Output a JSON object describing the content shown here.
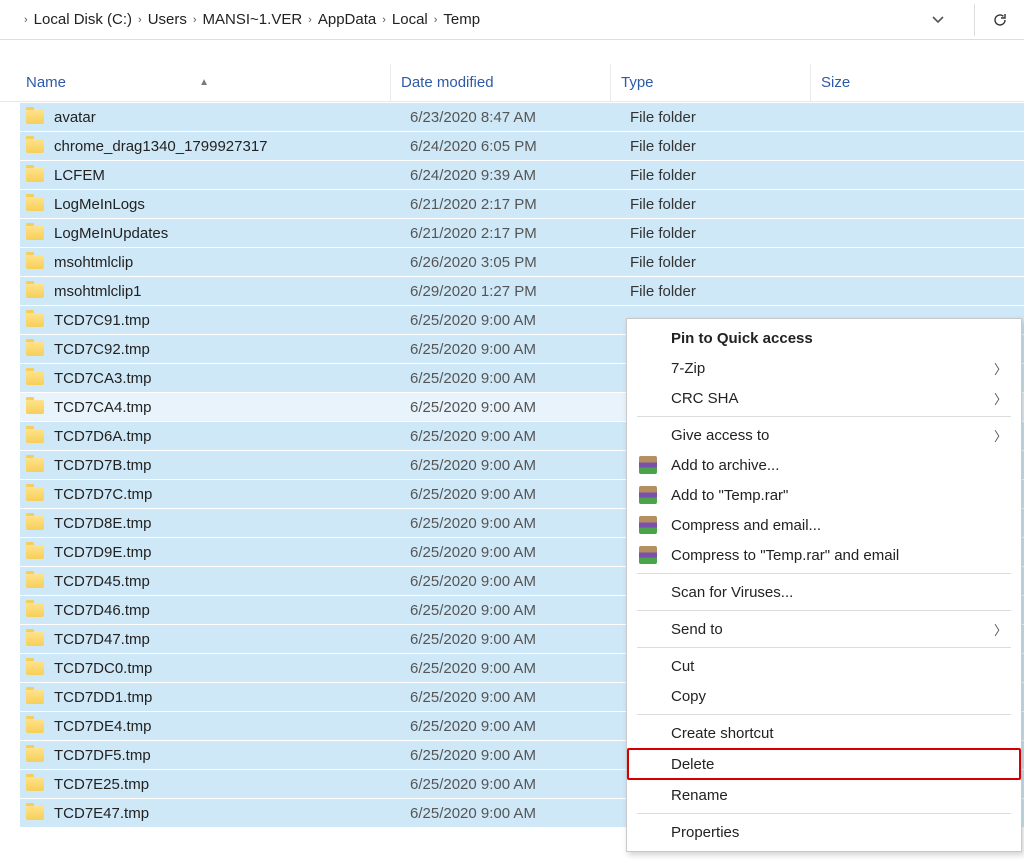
{
  "breadcrumbs": [
    {
      "label": "Local Disk (C:)"
    },
    {
      "label": "Users"
    },
    {
      "label": "MANSI~1.VER"
    },
    {
      "label": "AppData"
    },
    {
      "label": "Local"
    },
    {
      "label": "Temp"
    }
  ],
  "columns": {
    "name": "Name",
    "date": "Date modified",
    "type": "Type",
    "size": "Size"
  },
  "rows": [
    {
      "name": "avatar",
      "date": "6/23/2020 8:47 AM",
      "type": "File folder"
    },
    {
      "name": "chrome_drag1340_1799927317",
      "date": "6/24/2020 6:05 PM",
      "type": "File folder"
    },
    {
      "name": "LCFEM",
      "date": "6/24/2020 9:39 AM",
      "type": "File folder"
    },
    {
      "name": "LogMeInLogs",
      "date": "6/21/2020 2:17 PM",
      "type": "File folder"
    },
    {
      "name": "LogMeInUpdates",
      "date": "6/21/2020 2:17 PM",
      "type": "File folder"
    },
    {
      "name": "msohtmlclip",
      "date": "6/26/2020 3:05 PM",
      "type": "File folder"
    },
    {
      "name": "msohtmlclip1",
      "date": "6/29/2020 1:27 PM",
      "type": "File folder"
    },
    {
      "name": "TCD7C91.tmp",
      "date": "6/25/2020 9:00 AM",
      "type": ""
    },
    {
      "name": "TCD7C92.tmp",
      "date": "6/25/2020 9:00 AM",
      "type": ""
    },
    {
      "name": "TCD7CA3.tmp",
      "date": "6/25/2020 9:00 AM",
      "type": ""
    },
    {
      "name": "TCD7CA4.tmp",
      "date": "6/25/2020 9:00 AM",
      "type": ""
    },
    {
      "name": "TCD7D6A.tmp",
      "date": "6/25/2020 9:00 AM",
      "type": ""
    },
    {
      "name": "TCD7D7B.tmp",
      "date": "6/25/2020 9:00 AM",
      "type": ""
    },
    {
      "name": "TCD7D7C.tmp",
      "date": "6/25/2020 9:00 AM",
      "type": ""
    },
    {
      "name": "TCD7D8E.tmp",
      "date": "6/25/2020 9:00 AM",
      "type": ""
    },
    {
      "name": "TCD7D9E.tmp",
      "date": "6/25/2020 9:00 AM",
      "type": ""
    },
    {
      "name": "TCD7D45.tmp",
      "date": "6/25/2020 9:00 AM",
      "type": ""
    },
    {
      "name": "TCD7D46.tmp",
      "date": "6/25/2020 9:00 AM",
      "type": ""
    },
    {
      "name": "TCD7D47.tmp",
      "date": "6/25/2020 9:00 AM",
      "type": ""
    },
    {
      "name": "TCD7DC0.tmp",
      "date": "6/25/2020 9:00 AM",
      "type": ""
    },
    {
      "name": "TCD7DD1.tmp",
      "date": "6/25/2020 9:00 AM",
      "type": ""
    },
    {
      "name": "TCD7DE4.tmp",
      "date": "6/25/2020 9:00 AM",
      "type": ""
    },
    {
      "name": "TCD7DF5.tmp",
      "date": "6/25/2020 9:00 AM",
      "type": ""
    },
    {
      "name": "TCD7E25.tmp",
      "date": "6/25/2020 9:00 AM",
      "type": ""
    },
    {
      "name": "TCD7E47.tmp",
      "date": "6/25/2020 9:00 AM",
      "type": ""
    }
  ],
  "contextMenu": {
    "pin": "Pin to Quick access",
    "sevenZip": "7-Zip",
    "crcSha": "CRC SHA",
    "giveAccess": "Give access to",
    "addArchive": "Add to archive...",
    "addTempRar": "Add to \"Temp.rar\"",
    "compressEmail": "Compress and email...",
    "compressTempEmail": "Compress to \"Temp.rar\" and email",
    "scanViruses": "Scan for Viruses...",
    "sendTo": "Send to",
    "cut": "Cut",
    "copy": "Copy",
    "createShortcut": "Create shortcut",
    "delete": "Delete",
    "rename": "Rename",
    "properties": "Properties"
  }
}
